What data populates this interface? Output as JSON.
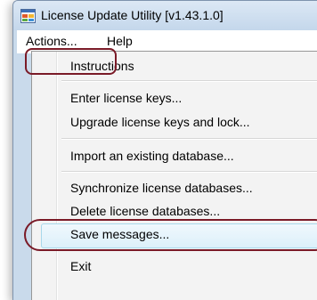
{
  "window": {
    "title": "License Update Utility [v1.43.1.0]",
    "app_icon": "app-window-icon"
  },
  "menubar": {
    "items": [
      "Actions...",
      "Help"
    ]
  },
  "actions_menu": {
    "items": [
      {
        "label": "Instructions"
      },
      {
        "label": "Enter license keys..."
      },
      {
        "label": "Upgrade license keys and lock..."
      },
      {
        "label": "Import an existing database..."
      },
      {
        "label": "Synchronize license databases..."
      },
      {
        "label": "Delete license databases..."
      },
      {
        "label": "Save messages...",
        "highlighted": true
      },
      {
        "label": "Exit"
      }
    ]
  },
  "colors": {
    "annotation": "#7a1a27",
    "highlight_border": "#a8d8eb",
    "highlight_fill": "#dcf0fa"
  }
}
